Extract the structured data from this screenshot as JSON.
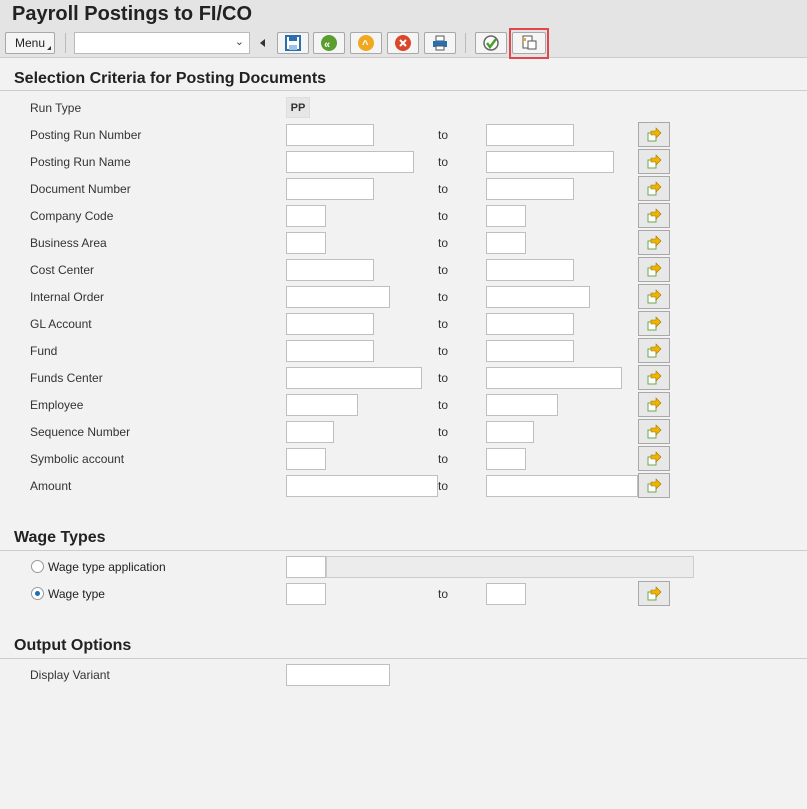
{
  "title": "Payroll Postings to FI/CO",
  "toolbar": {
    "menu_label": "Menu",
    "command_field": "",
    "buttons": [
      "save-icon",
      "back-icon",
      "exit-icon",
      "cancel-icon",
      "print-icon",
      "execute-icon",
      "multiple-selection-icon"
    ]
  },
  "selection": {
    "heading": "Selection Criteria for Posting Documents",
    "run_type_label": "Run Type",
    "run_type_value": "PP",
    "to_label": "to",
    "rows": [
      "Posting Run Number",
      "Posting Run Name",
      "Document Number",
      "Company Code",
      "Business Area",
      "Cost Center",
      "Internal Order",
      "GL Account",
      "Fund",
      "Funds Center",
      "Employee",
      "Sequence Number",
      "Symbolic account",
      "Amount"
    ]
  },
  "wage_types": {
    "heading": "Wage Types",
    "option_application": "Wage type application",
    "option_wage_type": "Wage type",
    "selected": "Wage type",
    "to_label": "to"
  },
  "output": {
    "heading": "Output Options",
    "display_variant_label": "Display Variant",
    "display_variant_value": ""
  }
}
